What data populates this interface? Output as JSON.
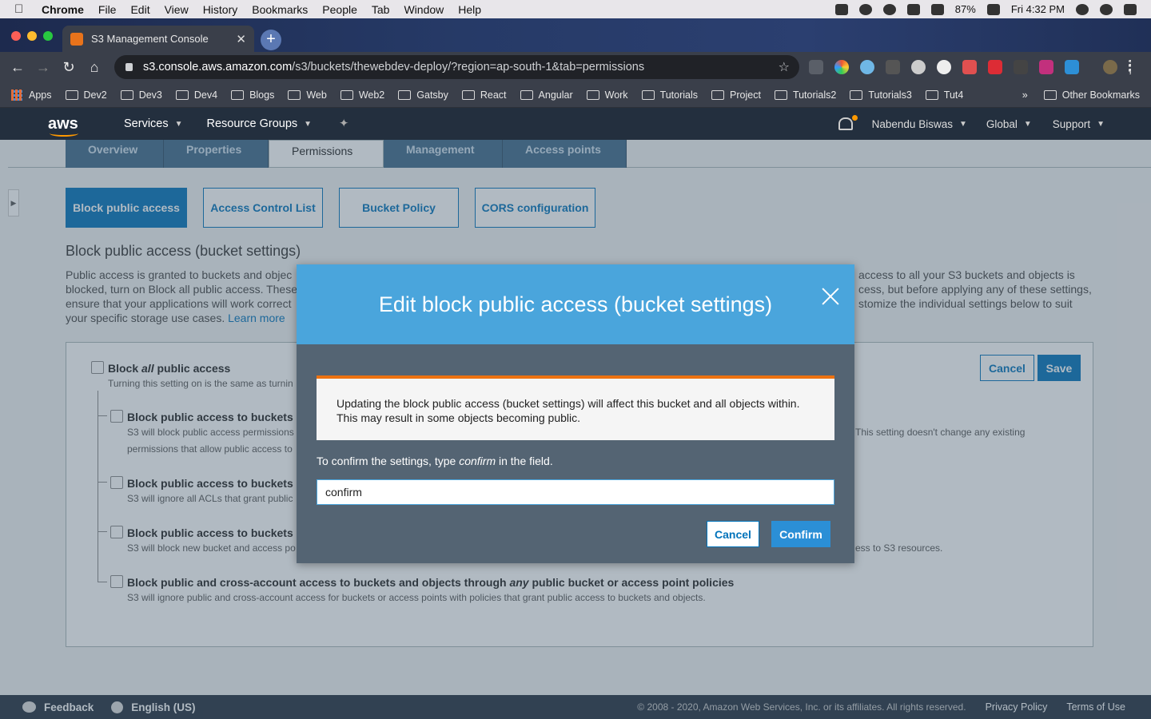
{
  "menubar": {
    "app": "Chrome",
    "items": [
      "File",
      "Edit",
      "View",
      "History",
      "Bookmarks",
      "People",
      "Tab",
      "Window",
      "Help"
    ],
    "battery": "87%",
    "clock": "Fri 4:32 PM"
  },
  "browser": {
    "tab_title": "S3 Management Console",
    "url_host": "s3.console.aws.amazon.com",
    "url_path": "/s3/buckets/thewebdev-deploy/?region=ap-south-1&tab=permissions",
    "bookmarks": [
      "Apps",
      "Dev2",
      "Dev3",
      "Dev4",
      "Blogs",
      "Web",
      "Web2",
      "Gatsby",
      "React",
      "Angular",
      "Work",
      "Tutorials",
      "Project",
      "Tutorials2",
      "Tutorials3",
      "Tut4"
    ],
    "overflow": "»",
    "other_bookmarks": "Other Bookmarks"
  },
  "aws_nav": {
    "logo": "aws",
    "services": "Services",
    "resource_groups": "Resource Groups",
    "user": "Nabendu Biswas",
    "region": "Global",
    "support": "Support"
  },
  "page": {
    "tabs": [
      "Overview",
      "Properties",
      "Permissions",
      "Management",
      "Access points"
    ],
    "subtabs": [
      "Block public access",
      "Access Control List",
      "Bucket Policy",
      "CORS configuration"
    ],
    "section_title": "Block public access (bucket settings)",
    "desc_left": [
      "Public access is granted to buckets and objec",
      "blocked, turn on Block all public access. These",
      "ensure that your applications will work correct",
      "your specific storage use cases."
    ],
    "learn_more": "Learn more",
    "desc_right": [
      "access to all your S3 buckets and objects is",
      "cess, but before applying any of these settings,",
      "stomize the individual settings below to suit"
    ],
    "cancel": "Cancel",
    "save": "Save",
    "block_all_pre": "Block ",
    "block_all_em": "all",
    "block_all_post": " public access",
    "block_all_sub": "Turning this setting on is the same as turnin",
    "opt1_label": "Block public access to buckets",
    "opt1_sub1": "S3 will block public access permissions",
    "opt1_sub2": "permissions that allow public access to",
    "opt1_right": "This setting doesn't change any existing",
    "opt2_label": "Block public access to buckets",
    "opt2_sub": "S3 will ignore all ACLs that grant public",
    "opt3_label": "Block public access to buckets",
    "opt3_sub": "S3 will block new bucket and access po",
    "opt3_right": "ess to S3 resources.",
    "opt4_pre": "Block public and cross-account access to buckets and objects through ",
    "opt4_em": "any",
    "opt4_post": " public bucket or access point policies",
    "opt4_sub": "S3 will ignore public and cross-account access for buckets or access points with policies that grant public access to buckets and objects."
  },
  "modal": {
    "title": "Edit block public access (bucket settings)",
    "warning_line1": "Updating the block public access (bucket settings) will affect this bucket and all objects within.",
    "warning_line2": "This may result in some objects becoming public.",
    "confirm_pre": "To confirm the settings, type ",
    "confirm_em": "confirm",
    "confirm_post": " in the field.",
    "input_value": "confirm",
    "cancel": "Cancel",
    "confirm": "Confirm"
  },
  "footer": {
    "feedback": "Feedback",
    "language": "English (US)",
    "copyright": "© 2008 - 2020, Amazon Web Services, Inc. or its affiliates. All rights reserved.",
    "privacy": "Privacy Policy",
    "terms": "Terms of Use"
  },
  "colors": {
    "aws_nav": "#232f3e",
    "accent": "#0073bb",
    "modal_header": "#4aa5dc",
    "warning": "#ec7211"
  }
}
